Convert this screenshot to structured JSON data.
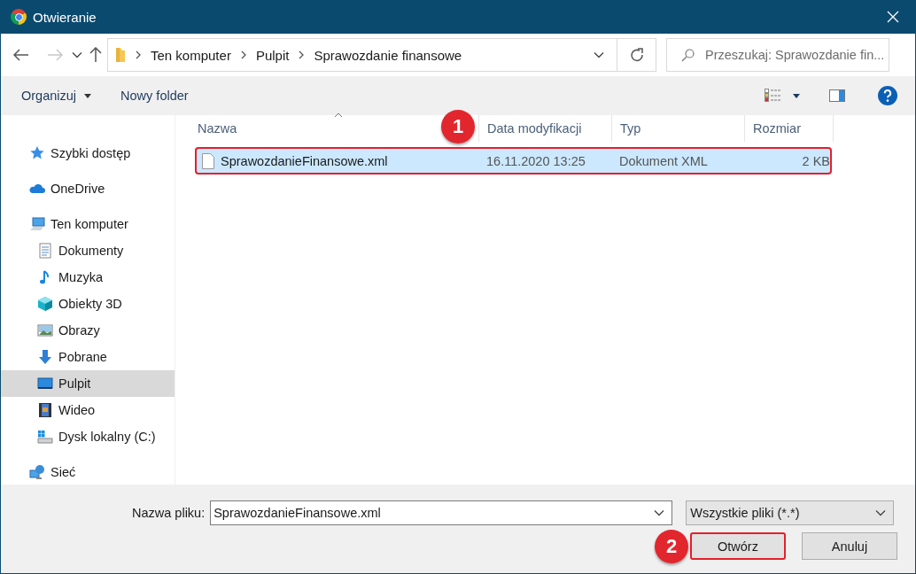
{
  "window": {
    "title": "Otwieranie"
  },
  "address_bar": {
    "path": [
      "Ten komputer",
      "Pulpit",
      "Sprawozdanie finansowe"
    ],
    "search": {
      "placeholder": "Przeszukaj: Sprawozdanie fin..."
    }
  },
  "toolbar": {
    "organize": "Organizuj",
    "new_folder": "Nowy folder"
  },
  "sidebar": {
    "items": [
      {
        "label": "Szybki dostęp",
        "kind": "star",
        "selected": false
      },
      {
        "label": "OneDrive",
        "kind": "cloud",
        "selected": false
      },
      {
        "label": "Ten komputer",
        "kind": "computer",
        "selected": false,
        "children": [
          {
            "label": "Dokumenty",
            "kind": "document",
            "selected": false
          },
          {
            "label": "Muzyka",
            "kind": "music",
            "selected": false
          },
          {
            "label": "Obiekty 3D",
            "kind": "cube",
            "selected": false
          },
          {
            "label": "Obrazy",
            "kind": "image",
            "selected": false
          },
          {
            "label": "Pobrane",
            "kind": "download",
            "selected": false
          },
          {
            "label": "Pulpit",
            "kind": "desktop",
            "selected": true
          },
          {
            "label": "Wideo",
            "kind": "video",
            "selected": false
          },
          {
            "label": "Dysk lokalny (C:)",
            "kind": "drive",
            "selected": false
          }
        ]
      },
      {
        "label": "Sieć",
        "kind": "network",
        "selected": false
      }
    ]
  },
  "file_list": {
    "badge": "1",
    "columns": [
      {
        "label": "Nazwa",
        "sorted": true
      },
      {
        "label": "Data modyfikacji",
        "sorted": false
      },
      {
        "label": "Typ",
        "sorted": false
      },
      {
        "label": "Rozmiar",
        "sorted": false
      }
    ],
    "rows": [
      {
        "cells": [
          "SprawozdanieFinansowe.xml",
          "16.11.2020 13:25",
          "Dokument XML",
          "2 KB"
        ],
        "selected": true,
        "highlighted": true
      }
    ]
  },
  "footer": {
    "badge": "2",
    "filename_label": "Nazwa pliku:",
    "filename": "SprawozdanieFinansowe.xml",
    "filter": "Wszystkie pliki (*.*)",
    "buttons": [
      {
        "label": "Otwórz",
        "highlighted": true
      },
      {
        "label": "Anuluj",
        "highlighted": false
      }
    ]
  }
}
